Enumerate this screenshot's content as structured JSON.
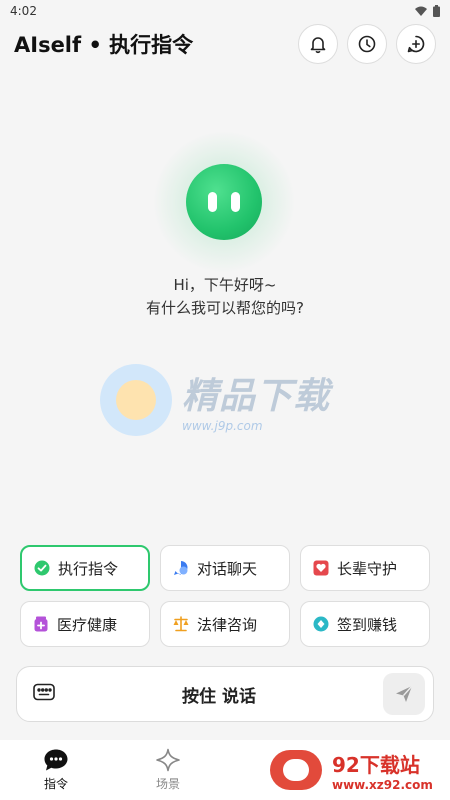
{
  "status_bar": {
    "time": "4:02"
  },
  "header": {
    "title": "AIself • 执行指令"
  },
  "greeting": {
    "line1": "Hi，下午好呀~",
    "line2": "有什么我可以帮您的吗?"
  },
  "watermark": {
    "title": "精品下载",
    "url": "www.j9p.com"
  },
  "commands": [
    {
      "label": "执行指令",
      "icon": "check-circle-icon",
      "color": "#2ec86e",
      "active": true
    },
    {
      "label": "对话聊天",
      "icon": "chat-bubble-icon",
      "color": "#3a7bf0"
    },
    {
      "label": "长辈守护",
      "icon": "heart-shield-icon",
      "color": "#e5484d"
    },
    {
      "label": "医疗健康",
      "icon": "medicine-icon",
      "color": "#b452d9"
    },
    {
      "label": "法律咨询",
      "icon": "scales-icon",
      "color": "#f0a020"
    },
    {
      "label": "签到赚钱",
      "icon": "coin-icon",
      "color": "#2bb8c6"
    }
  ],
  "voice": {
    "label": "按住 说话"
  },
  "tabs": [
    {
      "label": "指令",
      "icon": "chat-dots-icon",
      "active": true
    },
    {
      "label": "场景",
      "icon": "sparkle-diamond-icon"
    }
  ],
  "ad": {
    "title": "92下载站",
    "url": "www.xz92.com"
  },
  "colors": {
    "accent": "#2ec86e"
  }
}
